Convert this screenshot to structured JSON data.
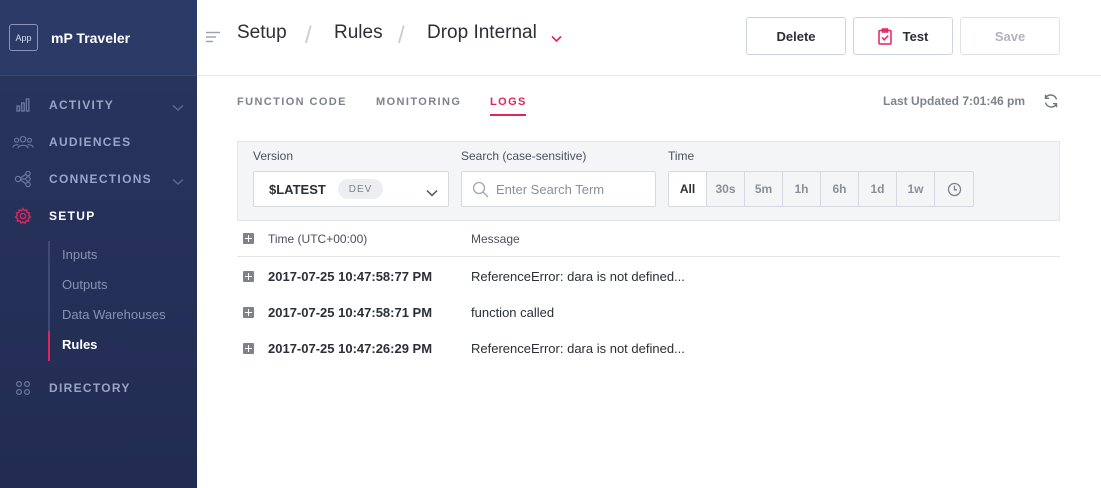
{
  "sidebar": {
    "app_badge": "App",
    "app_name": "mP Traveler",
    "items": [
      {
        "label": "ACTIVITY",
        "icon": "bar-chart-icon"
      },
      {
        "label": "AUDIENCES",
        "icon": "people-icon"
      },
      {
        "label": "CONNECTIONS",
        "icon": "connections-icon"
      },
      {
        "label": "SETUP",
        "icon": "gear-icon"
      },
      {
        "label": "DIRECTORY",
        "icon": "grid-icon"
      }
    ],
    "setup_subitems": [
      "Inputs",
      "Outputs",
      "Data Warehouses",
      "Rules"
    ]
  },
  "header": {
    "breadcrumb": [
      "Setup",
      "Rules",
      "Drop Internal"
    ],
    "separator": "/",
    "buttons": {
      "delete": "Delete",
      "test": "Test",
      "save": "Save"
    }
  },
  "tabs": [
    "FUNCTION CODE",
    "MONITORING",
    "LOGS"
  ],
  "last_updated": "Last Updated 7:01:46 pm",
  "filters": {
    "version_label": "Version",
    "version_value": "$LATEST",
    "version_badge": "DEV",
    "search_label": "Search (case-sensitive)",
    "search_placeholder": "Enter Search Term",
    "time_label": "Time",
    "time_options": [
      "All",
      "30s",
      "5m",
      "1h",
      "6h",
      "1d",
      "1w"
    ],
    "time_selected": "All"
  },
  "table": {
    "columns": [
      "Time (UTC+00:00)",
      "Message"
    ],
    "rows": [
      {
        "time": "2017-07-25 10:47:58:77 PM",
        "message": "ReferenceError: dara is not defined..."
      },
      {
        "time": "2017-07-25 10:47:58:71 PM",
        "message": "function called"
      },
      {
        "time": "2017-07-25 10:47:26:29 PM",
        "message": "ReferenceError: dara is not defined..."
      }
    ]
  },
  "colors": {
    "accent": "#e0245e",
    "sidebar": "#263159"
  }
}
